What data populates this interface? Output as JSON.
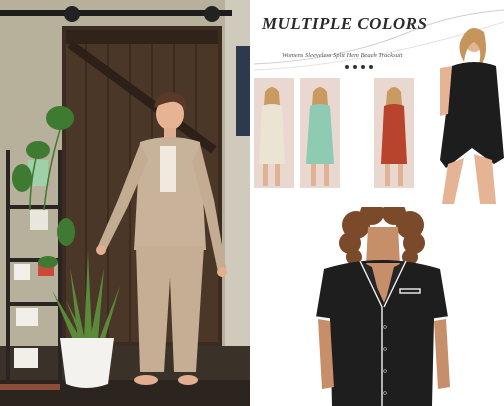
{
  "collage": {
    "panels": [
      "lifestyle-photo",
      "product-banner",
      "product-photo"
    ]
  },
  "banner": {
    "title": "MULTIPLE COLORS",
    "subtitle": "Womens Sleeveless Split Hem Beach Tracksuit",
    "pager_dots": 4,
    "colors": {
      "cream": "#ece4d3",
      "mint": "#8fcbb2",
      "rust": "#b8442e",
      "black": "#1d1d1d",
      "swatch_background": "#e9d8cf"
    }
  },
  "photos": {
    "lifestyle": {
      "outfit_color": "#c9b399",
      "door_color": "#3a2a1f"
    },
    "pajama": {
      "shirt_color": "#1e1e1e",
      "piping_color": "#f2f2f2"
    }
  }
}
